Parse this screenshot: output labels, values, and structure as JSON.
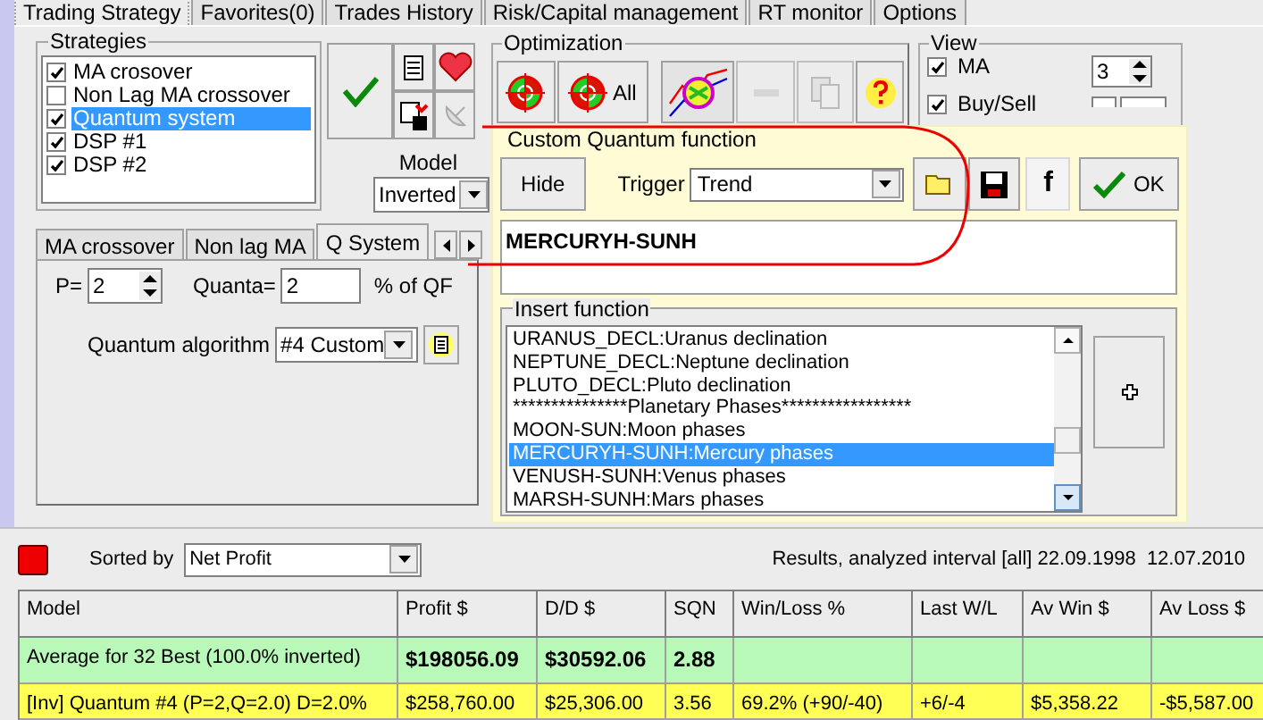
{
  "tabs": [
    {
      "label": "Trading Strategy",
      "selected": true
    },
    {
      "label": "Favorites(0)",
      "selected": false
    },
    {
      "label": "Trades History",
      "selected": false
    },
    {
      "label": "Risk/Capital management",
      "selected": false
    },
    {
      "label": "RT monitor",
      "selected": false
    },
    {
      "label": "Options",
      "selected": false
    }
  ],
  "strategies": {
    "title": "Strategies",
    "items": [
      {
        "label": "MA crosover",
        "checked": true,
        "selected": false
      },
      {
        "label": "Non Lag MA crossover",
        "checked": false,
        "selected": false
      },
      {
        "label": "Quantum system",
        "checked": true,
        "selected": true
      },
      {
        "label": "DSP #1",
        "checked": true,
        "selected": false
      },
      {
        "label": "DSP #2",
        "checked": true,
        "selected": false
      }
    ]
  },
  "model": {
    "label": "Model",
    "value": "Inverted"
  },
  "sub_tabs": [
    {
      "label": "MA crossover",
      "selected": false
    },
    {
      "label": "Non lag MA",
      "selected": false
    },
    {
      "label": "Q System",
      "selected": true
    }
  ],
  "q_system": {
    "p_label": "P=",
    "p_value": "2",
    "quanta_label": "Quanta=",
    "quanta_value": "2",
    "quanta_unit": "% of QF",
    "algorithm_label": "Quantum algorithm",
    "algorithm_value": "#4 Custom"
  },
  "optimization": {
    "title": "Optimization",
    "buttons": [
      {
        "kind": "target",
        "disabled": false
      },
      {
        "kind": "target",
        "label": "All",
        "disabled": false
      },
      {
        "kind": "chart",
        "disabled": false
      },
      {
        "kind": "minus",
        "disabled": true
      },
      {
        "kind": "copy",
        "disabled": true
      },
      {
        "kind": "help",
        "disabled": false
      }
    ]
  },
  "view": {
    "title": "View",
    "items": [
      {
        "label": "MA",
        "checked": true
      },
      {
        "label": "Buy/Sell",
        "checked": true
      }
    ],
    "spinner_value": "3"
  },
  "custom_function": {
    "title": "Custom Quantum function",
    "hide_button": "Hide",
    "trigger_label": "Trigger",
    "trigger_value": "Trend",
    "f_button": "f",
    "ok_button": "OK",
    "expression": "MERCURYH-SUNH",
    "insert_title": "Insert function",
    "functions": [
      {
        "label": "URANUS_DECL:Uranus declination",
        "selected": false
      },
      {
        "label": "NEPTUNE_DECL:Neptune declination",
        "selected": false
      },
      {
        "label": "PLUTO_DECL:Pluto declination",
        "selected": false
      },
      {
        "label": "***************Planetary Phases*****************",
        "selected": false
      },
      {
        "label": "MOON-SUN:Moon phases",
        "selected": false
      },
      {
        "label": "MERCURYH-SUNH:Mercury phases",
        "selected": true
      },
      {
        "label": "VENUSH-SUNH:Venus phases",
        "selected": false
      },
      {
        "label": "MARSH-SUNH:Mars phases",
        "selected": false
      }
    ]
  },
  "results": {
    "sorted_by_label": "Sorted by",
    "sort_value": "Net Profit",
    "interval": "Results, analyzed interval [all] 22.09.1998  12.07.2010"
  },
  "table": {
    "columns": [
      "Model",
      "Profit $",
      "D/D $",
      "SQN",
      "Win/Loss %",
      "Last W/L",
      "Av Win $",
      "Av Loss $"
    ],
    "rows": [
      {
        "kind": "average",
        "cells": [
          "Average for 32 Best (100.0% inverted)",
          "$198056.09",
          "$30592.06",
          "2.88",
          "",
          "",
          "",
          ""
        ]
      },
      {
        "kind": "result",
        "cells": [
          "[Inv] Quantum #4 (P=2,Q=2.0) D=2.0%",
          "$258,760.00",
          "$25,306.00",
          "3.56",
          "69.2% (+90/-40)",
          "+6/-4",
          "$5,358.22",
          "-$5,587.00"
        ]
      }
    ]
  }
}
